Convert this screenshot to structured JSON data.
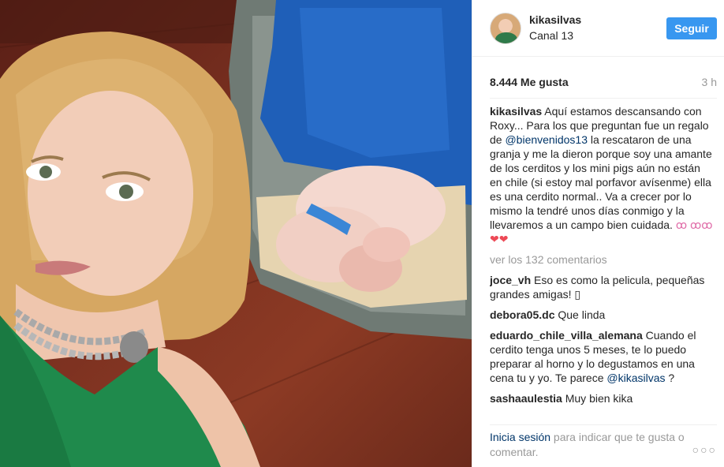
{
  "post": {
    "username": "kikasilvas",
    "location": "Canal 13",
    "follow_label": "Seguir",
    "likes": "8.444 Me gusta",
    "time": "3 h"
  },
  "caption": {
    "user": "kikasilvas",
    "text_before": " Aquí estamos descansando con Roxy... Para los que preguntan fue un regalo de ",
    "mention": "@bienvenidos13",
    "text_after": " la rescataron de una granja y me la dieron porque soy una amante de los cerditos y los mini pigs aún no están en chile (si estoy mal porfavor avísenme) ella es una cerdito normal.. Va a crecer por lo mismo la tendré unos días conmigo y la llevaremos a un campo bien cuidada. ",
    "emoji_pigs": "ꝏ ꝏꝏ",
    "emoji_hearts": "❤❤"
  },
  "view_more": "ver los 132 comentarios",
  "comments": [
    {
      "user": "joce_vh",
      "text": " Eso es como la pelicula, pequeñas grandes amigas! ▯"
    },
    {
      "user": "debora05.dc",
      "text": " Que linda"
    },
    {
      "user": "eduardo_chile_villa_alemana",
      "text": " Cuando el cerdito tenga unos 5 meses, te lo puedo preparar al horno y lo degustamos en una cena tu y yo. Te parece ",
      "mention": "@kikasilvas",
      "tail": " ?"
    },
    {
      "user": "sashaaulestia",
      "text": " Muy bien kika"
    }
  ],
  "footer": {
    "login_link": "Inicia sesión",
    "login_text": " para indicar que te gusta o comentar.",
    "options": "○○○"
  }
}
